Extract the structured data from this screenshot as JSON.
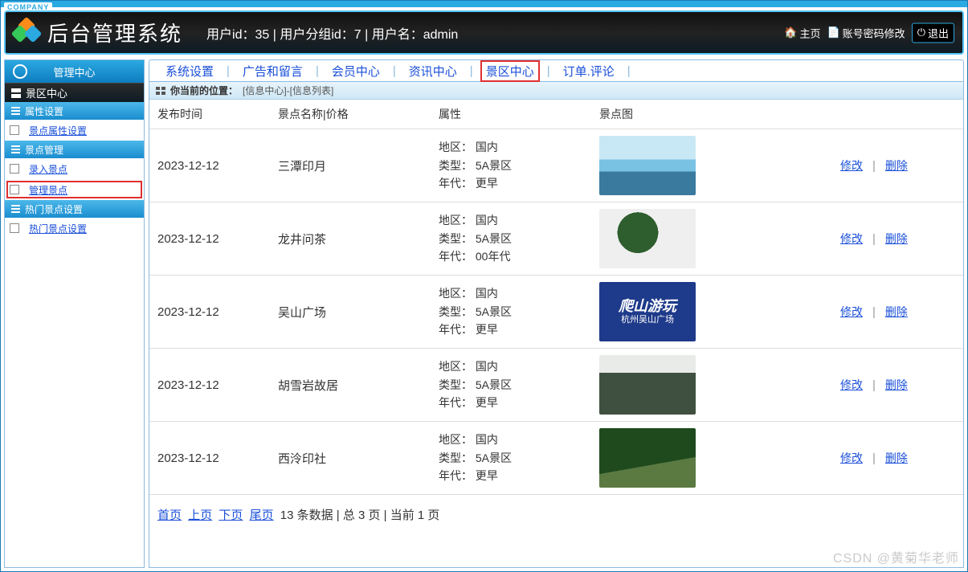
{
  "company": "COMPANY",
  "title": "后台管理系统",
  "user_line": "用户id：35 | 用户分组id：7 | 用户名：admin",
  "header_links": {
    "home": "主页",
    "pwd": "账号密码修改",
    "logout": "退出"
  },
  "topnav": {
    "items": [
      "系统设置",
      "广告和留言",
      "会员中心",
      "资讯中心",
      "景区中心",
      "订单.评论"
    ],
    "highlight_index": 4
  },
  "sidebar": {
    "center": "管理中心",
    "section": "景区中心",
    "groups": [
      {
        "title": "属性设置",
        "links": [
          {
            "text": "景点属性设置",
            "hl": false
          }
        ]
      },
      {
        "title": "景点管理",
        "links": [
          {
            "text": "录入景点",
            "hl": false
          },
          {
            "text": "管理景点",
            "hl": true
          }
        ]
      },
      {
        "title": "热门景点设置",
        "links": [
          {
            "text": "热门景点设置",
            "hl": false
          }
        ]
      }
    ]
  },
  "crumb": {
    "label": "你当前的位置：",
    "loc": "[信息中心]-[信息列表]"
  },
  "table": {
    "headers": [
      "发布时间",
      "景点名称|价格",
      "属性",
      "景点图",
      ""
    ],
    "attr_labels": {
      "region": "地区：",
      "type": "类型：",
      "era": "年代："
    },
    "ops": {
      "edit": "修改",
      "delete": "删除"
    },
    "rows": [
      {
        "date": "2023-12-12",
        "name": "三潭印月",
        "region": "国内",
        "type": "5A景区",
        "era": "更早",
        "thumb_class": "t1",
        "thumb_text1": "",
        "thumb_text2": ""
      },
      {
        "date": "2023-12-12",
        "name": "龙井问茶",
        "region": "国内",
        "type": "5A景区",
        "era": "00年代",
        "thumb_class": "t2",
        "thumb_text1": "",
        "thumb_text2": ""
      },
      {
        "date": "2023-12-12",
        "name": "吴山广场",
        "region": "国内",
        "type": "5A景区",
        "era": "更早",
        "thumb_class": "t3",
        "thumb_text1": "爬山游玩",
        "thumb_text2": "杭州吴山广场"
      },
      {
        "date": "2023-12-12",
        "name": "胡雪岩故居",
        "region": "国内",
        "type": "5A景区",
        "era": "更早",
        "thumb_class": "t4",
        "thumb_text1": "",
        "thumb_text2": ""
      },
      {
        "date": "2023-12-12",
        "name": "西泠印社",
        "region": "国内",
        "type": "5A景区",
        "era": "更早",
        "thumb_class": "t5",
        "thumb_text1": "",
        "thumb_text2": ""
      }
    ]
  },
  "pager": {
    "first": "首页",
    "prev": "上页",
    "next": "下页",
    "last": "尾页",
    "info": "13 条数据 | 总 3 页 | 当前 1 页"
  },
  "watermark": "CSDN @黄菊华老师"
}
